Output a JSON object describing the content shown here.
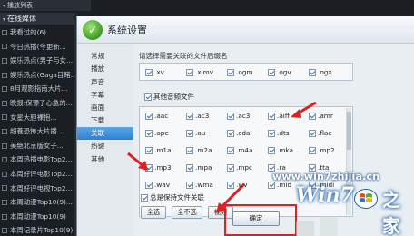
{
  "player": {
    "header": "播放列表",
    "tab": "在线媒体",
    "items": [
      "我看过的(6)",
      "今日热播(今更新...",
      "娱乐热点(男子与女...",
      "娱乐热点(Gaga目睹...",
      "8月观影指南大片...",
      "晚报:保镖子心急的...",
      "女星大胆裸抱...",
      "超養恐怖大片播...",
      "美绝北京版女子...",
      "本周热播电影Top2...",
      "本周好评电影Top2...",
      "本周好评电视Top2...",
      "本周动漫Top10(9)...",
      "本周动漫Top10(9)",
      "本周记录片Top10(9)"
    ]
  },
  "dialog": {
    "title": "系统设置",
    "nav": [
      "常规",
      "播放",
      "声音",
      "字幕",
      "画面",
      "下载",
      "关联",
      "热键",
      "其他"
    ],
    "active_nav_index": 6,
    "hint": "请选择需要关联的文件后缀名",
    "row_a": [
      ".xv",
      ".xlmv",
      ".ogm",
      ".ogv",
      ".ogx"
    ],
    "section_label": "其他音频文件",
    "audio_rows": [
      [
        ".aac",
        ".ac3",
        ".ac3",
        ".aiff",
        ".amr"
      ],
      [
        ".ape",
        ".au",
        ".cda",
        ".dts",
        ".flac"
      ],
      [
        ".m1a",
        ".m2a",
        ".m4a",
        ".mka",
        ".mp2"
      ],
      [
        ".mp3",
        ".mpa",
        ".mpc",
        ".ra",
        ".tta"
      ],
      [
        ".wav",
        ".wma",
        ".wv",
        ".mid",
        ".midi"
      ]
    ],
    "always_label": "总是保持文件关联",
    "buttons": {
      "select_all": "全选",
      "select_none": "全不选",
      "video": "视频"
    },
    "ok_label": "确定"
  },
  "watermark": {
    "url": "www.win7zhijia.cn",
    "logo": "Win7",
    "tail": "之家"
  },
  "colors": {
    "accent_nav": "#2e80cf",
    "annotation_red": "#e02020",
    "dialog_bg": "#e9eef3",
    "player_bg": "#1b1f24"
  }
}
